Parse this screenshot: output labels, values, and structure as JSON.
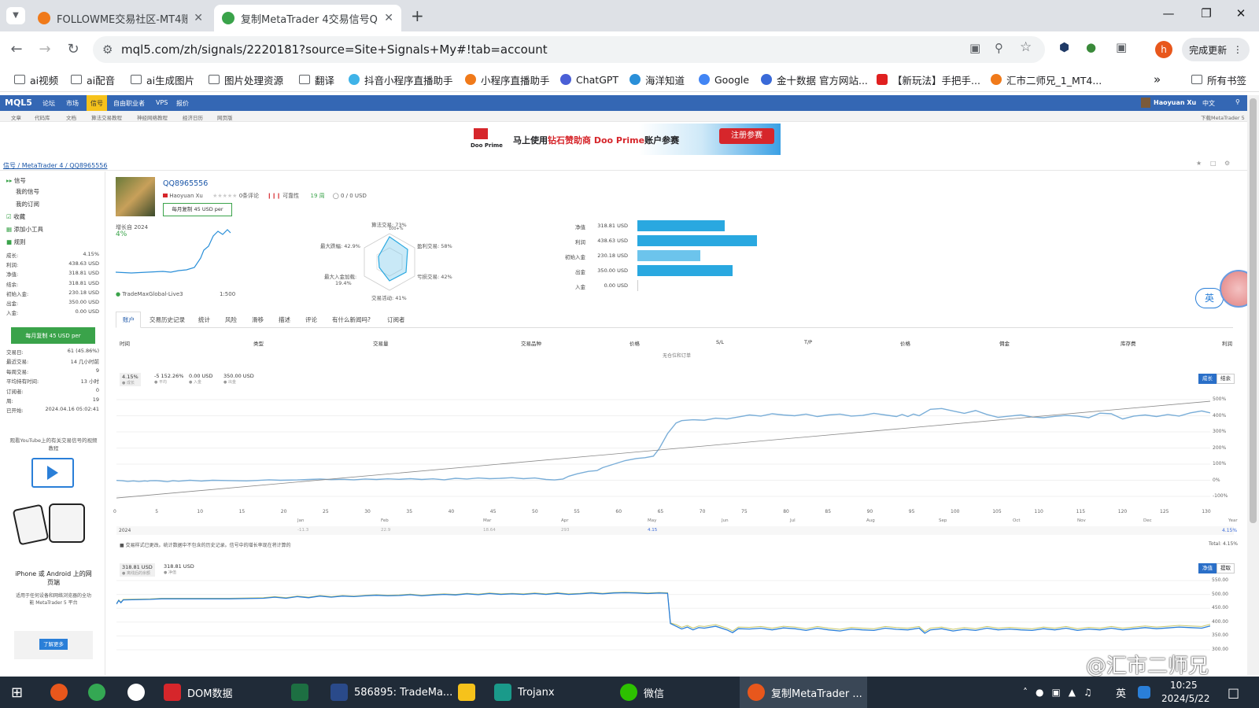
{
  "browser": {
    "tabs": [
      {
        "title": "FOLLOWME交易社区-MT4账F",
        "active": false
      },
      {
        "title": "复制MetaTrader 4交易信号QC",
        "active": true
      }
    ],
    "new_tab": "+",
    "url": "mql5.com/zh/signals/2220181?source=Site+Signals+My#!tab=account",
    "update_label": "完成更新",
    "profile_letter": "h",
    "bookmarks": [
      "ai视频",
      "ai配音",
      "ai生成图片",
      "图片处理资源",
      "翻译",
      "抖音小程序直播助手",
      "小程序直播助手",
      "ChatGPT",
      "海洋知道",
      "Google",
      "金十数据 官方网站...",
      "【新玩法】手把手...",
      "汇市二师兄_1_MT4..."
    ],
    "all_bookmarks": "所有书签",
    "more": "»"
  },
  "site": {
    "logo": "MQL5",
    "nav": [
      "论坛",
      "市场",
      "信号",
      "自由职业者",
      "VPS",
      "报价"
    ],
    "active_nav": "信号",
    "user": "Haoyuan Xu",
    "lang": "中文",
    "subnav": [
      "文章",
      "代码库",
      "文档",
      "算法交易教程",
      "神经网络教程",
      "经济日历",
      "网页版"
    ],
    "download": "下载MetaTrader 5",
    "banner": {
      "brand": "Doo Prime",
      "text_before": "马上使用",
      "highlight": "钻石赞助商 Doo Prime",
      "text_after": "账户参赛",
      "cta": "注册参赛"
    },
    "breadcrumb": [
      "信号",
      "MetaTrader 4",
      "QQ8965556"
    ]
  },
  "sidebar": {
    "nav": [
      "信号",
      "我的信号",
      "我的订阅",
      "收藏",
      "添加小工具",
      "规则"
    ],
    "stats": [
      {
        "k": "成长:",
        "v": "4.15%"
      },
      {
        "k": "利润:",
        "v": "438.63 USD"
      },
      {
        "k": "净值:",
        "v": "318.81 USD"
      },
      {
        "k": "结余:",
        "v": "318.81 USD"
      },
      {
        "k": "初始入金:",
        "v": "230.18 USD"
      },
      {
        "k": "出金:",
        "v": "350.00 USD"
      },
      {
        "k": "入金:",
        "v": "0.00 USD"
      }
    ],
    "subscribe": "每月复制 45 USD per",
    "stats2": [
      {
        "k": "交易日:",
        "v": "61 (45.86%)"
      },
      {
        "k": "最近交易:",
        "v": "14 几小时前"
      },
      {
        "k": "每周交易:",
        "v": "9"
      },
      {
        "k": "平均持有时间:",
        "v": "13 小时"
      },
      {
        "k": "订阅者:",
        "v": "0"
      },
      {
        "k": "周:",
        "v": "19"
      },
      {
        "k": "已开始:",
        "v": "2024.04.16 05:02:41"
      }
    ],
    "youtube": "观看YouTube上的有关交易信号的视频教程",
    "mobile_title": "iPhone 或 Android 上的网页端",
    "mobile_desc": "适用于任何设备和网络浏览器的全功能 MetaTrader 5 平台",
    "learn_more": "了解更多"
  },
  "signal": {
    "name": "QQ8965556",
    "author": "Haoyuan Xu",
    "reviews": "0条评论",
    "reliability": "可靠性",
    "weeks": "19 周",
    "subscribers": "0 / 0 USD",
    "copy_btn": "每月复制 45 USD per",
    "growth_label": "增长自 2024",
    "growth_value": "4%",
    "broker": "TradeMaxGlobal-Live3",
    "leverage": "1:500"
  },
  "radar": {
    "algo": "算法交易: 73%",
    "algo_sub": "100+%",
    "profit_trades": "盈利交易: 58%",
    "loss_trades": "亏损交易: 42%",
    "activity": "交易活动: 41%",
    "max_deposit": "最大入金加载:",
    "max_deposit_v": "19.4%",
    "max_drawdown": "最大跌幅: 42.9%"
  },
  "bars": [
    {
      "label": "净值",
      "value": "318.81 USD",
      "fraction": 0.727,
      "color": "#29a8e0"
    },
    {
      "label": "利润",
      "value": "438.63 USD",
      "fraction": 1.0,
      "color": "#29a8e0"
    },
    {
      "label": "初始入金",
      "value": "230.18 USD",
      "fraction": 0.525,
      "color": "#6cc4ec"
    },
    {
      "label": "出金",
      "value": "350.00 USD",
      "fraction": 0.798,
      "color": "#29a8e0"
    },
    {
      "label": "入金",
      "value": "0.00 USD",
      "fraction": 0.0,
      "color": "#29a8e0"
    }
  ],
  "tabs": [
    "账户",
    "交易历史记录",
    "统计",
    "风险",
    "滑移",
    "描述",
    "评论",
    "有什么新闻吗?",
    "订阅者"
  ],
  "table_headers": [
    "时间",
    "类型",
    "交易量",
    "交易品种",
    "价格",
    "S/L",
    "T/P",
    "价格",
    "佣金",
    "库存费",
    "利润"
  ],
  "no_orders": "无仓位和订单",
  "growth_chart": {
    "summary": [
      {
        "v": "4.15%",
        "l": "成长"
      },
      {
        "v": "-5 152.26%",
        "l": "平均"
      },
      {
        "v": "0.00 USD",
        "l": "入金"
      },
      {
        "v": "350.00 USD",
        "l": "出金"
      }
    ],
    "toggle": [
      "成长",
      "结余"
    ],
    "y_ticks": [
      "500%",
      "400%",
      "300%",
      "200%",
      "100%",
      "0%",
      "-100%"
    ],
    "x_ticks": [
      "0",
      "5",
      "10",
      "15",
      "20",
      "25",
      "30",
      "35",
      "40",
      "45",
      "50",
      "55",
      "60",
      "65",
      "70",
      "75",
      "80",
      "85",
      "90",
      "95",
      "100",
      "105",
      "110",
      "115",
      "120",
      "125",
      "130"
    ],
    "months": [
      "Jan",
      "Feb",
      "Mar",
      "Apr",
      "May",
      "Jun",
      "Jul",
      "Aug",
      "Sep",
      "Oct",
      "Nov",
      "Dec",
      "Year"
    ],
    "year": "2024",
    "month_vals": [
      "-11.3",
      "22.9",
      "18.64",
      "293",
      "4.15"
    ],
    "year_val": "4.15%",
    "note": "交易样式已更改。统计数据中不包含的历史记录。信号中的增长率现在将计算的",
    "total": "Total: 4.15%"
  },
  "balance_chart": {
    "summary": [
      {
        "v": "318.81 USD",
        "l": "离线后的余额"
      },
      {
        "v": "318.81 USD",
        "l": "净值"
      }
    ],
    "toggle": [
      "净值",
      "提取"
    ],
    "y_ticks": [
      "550.00",
      "500.00",
      "450.00",
      "400.00",
      "350.00",
      "300.00"
    ]
  },
  "float": {
    "lang_btn": "英"
  },
  "watermark": "@汇市二师兄",
  "taskbar": {
    "items": [
      "DOM数据",
      "586895: TradeMa...",
      "Trojanx",
      "微信",
      "复制MetaTrader ..."
    ],
    "ime": "英",
    "time": "10:25",
    "date": "2024/5/22"
  }
}
